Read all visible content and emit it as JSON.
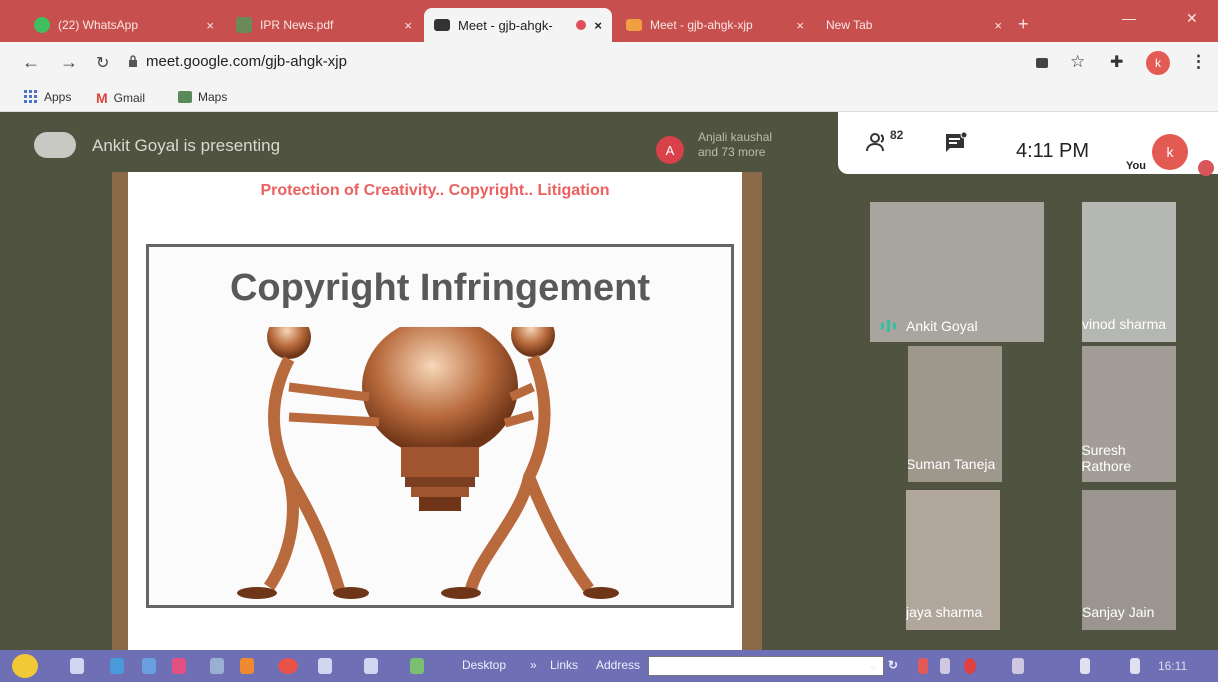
{
  "browser": {
    "tabs": [
      {
        "title": "(22) WhatsApp",
        "icon": "whatsapp-icon",
        "active": false
      },
      {
        "title": "IPR News.pdf",
        "icon": "pdf-icon",
        "active": false
      },
      {
        "title": "Meet - gjb-ahgk-",
        "icon": "meet-icon",
        "active": true
      },
      {
        "title": "Meet - gjb-ahgk-xjp",
        "icon": "meet-icon",
        "active": false
      },
      {
        "title": "New Tab",
        "icon": "",
        "active": false
      }
    ],
    "close_glyph": "×",
    "new_tab_glyph": "+",
    "url": "meet.google.com/gjb-ahgk-xjp",
    "profile_initial": "k"
  },
  "bookmarks": [
    {
      "label": "Apps",
      "icon": "apps-grid-icon"
    },
    {
      "label": "Gmail",
      "icon": "gmail-icon"
    },
    {
      "label": "Maps",
      "icon": "maps-icon"
    }
  ],
  "meet": {
    "presenting_text": "Ankit Goyal is presenting",
    "others_initial": "A",
    "others_line1": "Anjali kaushal",
    "others_line2": "and 73 more",
    "participant_count": "82",
    "time": "4:11 PM",
    "self_label": "You",
    "self_initial": "k",
    "slide_title": "Protection of Creativity.. Copyright.. Litigation",
    "slide_headline": "Copyright Infringement",
    "tiles": [
      {
        "name": "Ankit Goyal",
        "status": "speaking"
      },
      {
        "name": "vinod sharma",
        "status": "muted"
      },
      {
        "name": "Suman Taneja",
        "status": "muted"
      },
      {
        "name": "Suresh Rathore",
        "status": "muted"
      },
      {
        "name": "jaya sharma",
        "status": "muted"
      },
      {
        "name": "Sanjay Jain",
        "status": "muted"
      }
    ]
  },
  "taskbar": {
    "desktop_label": "Desktop",
    "links_label": "Links",
    "address_label": "Address",
    "chevron": "»",
    "time": "16:11"
  },
  "colors": {
    "tabstrip": "#c7504f",
    "meet_bg": "#505340",
    "muted_red": "#d8404a",
    "taskbar": "#6f6fb6"
  }
}
